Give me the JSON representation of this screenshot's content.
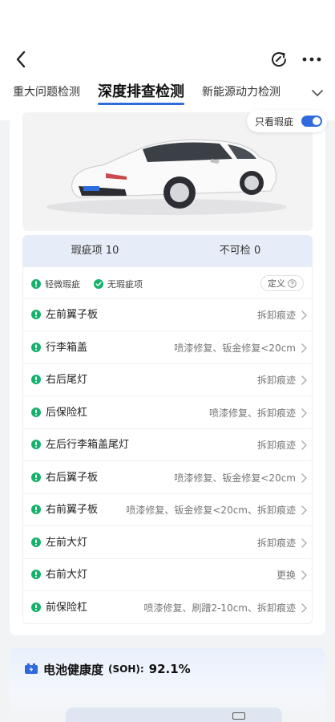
{
  "tabs": [
    "重大问题检测",
    "深度排查检测",
    "新能源动力检测"
  ],
  "toggle": {
    "label": "只看瑕疵",
    "on": true
  },
  "summary": {
    "defects_label": "瑕疵项",
    "defects_count": "10",
    "uncheckable_label": "不可检",
    "uncheckable_count": "0"
  },
  "legend": {
    "minor": "轻微瑕疵",
    "none": "无瑕疵项",
    "define": "定义"
  },
  "items": [
    {
      "name": "左前翼子板",
      "desc": "拆卸痕迹"
    },
    {
      "name": "行李箱盖",
      "desc": "喷漆修复、钣金修复<20cm"
    },
    {
      "name": "右后尾灯",
      "desc": "拆卸痕迹"
    },
    {
      "name": "后保险杠",
      "desc": "喷漆修复、拆卸痕迹"
    },
    {
      "name": "左后行李箱盖尾灯",
      "desc": "拆卸痕迹"
    },
    {
      "name": "右后翼子板",
      "desc": "喷漆修复、钣金修复<20cm"
    },
    {
      "name": "右前翼子板",
      "desc": "喷漆修复、钣金修复<20cm、拆卸痕迹"
    },
    {
      "name": "左前大灯",
      "desc": "拆卸痕迹"
    },
    {
      "name": "右前大灯",
      "desc": "更换"
    },
    {
      "name": "前保险杠",
      "desc": "喷漆修复、刷蹭2-10cm、拆卸痕迹"
    }
  ],
  "battery": {
    "title": "电池健康度",
    "soh_label": "(SOH):",
    "value": "92.1%"
  },
  "colors": {
    "accent": "#2f6bdc",
    "ok_green": "#16b26d"
  },
  "icons": {
    "back": "back-arrow-icon",
    "share": "share-icon",
    "more": "more-dots-icon",
    "expand": "chevron-down-icon",
    "battery": "battery-icon"
  }
}
